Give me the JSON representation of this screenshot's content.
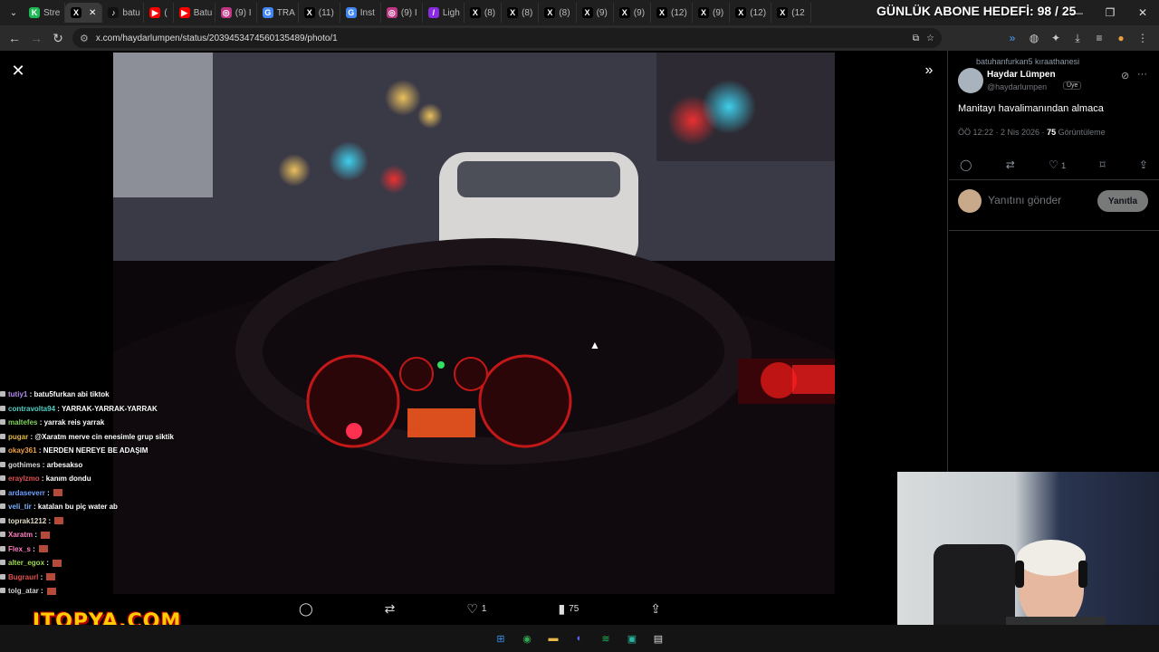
{
  "browser": {
    "tabs": [
      {
        "label": "Stre",
        "color": "#1DB954",
        "glyph": "K",
        "active": false
      },
      {
        "label": "",
        "color": "#000000",
        "glyph": "X",
        "active": true
      },
      {
        "label": "batu",
        "color": "#111111",
        "glyph": "♪",
        "active": false
      },
      {
        "label": "(",
        "color": "#FF0000",
        "glyph": "▶",
        "active": false
      },
      {
        "label": "Batu",
        "color": "#FF0000",
        "glyph": "▶",
        "active": false
      },
      {
        "label": "(9) I",
        "color": "#C13584",
        "glyph": "◎",
        "active": false
      },
      {
        "label": "TRA",
        "color": "#4285F4",
        "glyph": "G",
        "active": false
      },
      {
        "label": "(11)",
        "color": "#000000",
        "glyph": "X",
        "active": false
      },
      {
        "label": "Inst",
        "color": "#4285F4",
        "glyph": "G",
        "active": false
      },
      {
        "label": "(9) I",
        "color": "#C13584",
        "glyph": "◎",
        "active": false
      },
      {
        "label": "Ligh",
        "color": "#8A2BE2",
        "glyph": "/",
        "active": false
      },
      {
        "label": "(8)",
        "color": "#000000",
        "glyph": "X",
        "active": false
      },
      {
        "label": "(8)",
        "color": "#000000",
        "glyph": "X",
        "active": false
      },
      {
        "label": "(8)",
        "color": "#000000",
        "glyph": "X",
        "active": false
      },
      {
        "label": "(9)",
        "color": "#000000",
        "glyph": "X",
        "active": false
      },
      {
        "label": "(9)",
        "color": "#000000",
        "glyph": "X",
        "active": false
      },
      {
        "label": "(12)",
        "color": "#000000",
        "glyph": "X",
        "active": false
      },
      {
        "label": "(9)",
        "color": "#000000",
        "glyph": "X",
        "active": false
      },
      {
        "label": "(12)",
        "color": "#000000",
        "glyph": "X",
        "active": false
      },
      {
        "label": "(12",
        "color": "#000000",
        "glyph": "X",
        "active": false
      }
    ],
    "url": "x.com/haydarlumpen/status/2039453474560135489/photo/1"
  },
  "overlay": {
    "subscriber_goal": "GÜNLÜK ABONE HEDEFİ: 98 / 25",
    "logo": "ITOPYA.COM"
  },
  "tweet": {
    "retweet_label": "batuhanfurkan5 kıraathanesi",
    "author_name": "Haydar Lümpen",
    "author_handle": "@haydarlumpen",
    "member_badge": "Üye",
    "text": "Manitayı havalimanından almaca",
    "time": "ÖÖ 12:22 · 2 Nis 2026 ·",
    "views_count": "75",
    "views_label": "Görüntüleme",
    "likes": "1",
    "reply_placeholder": "Yanıtını gönder",
    "reply_button": "Yanıtla"
  },
  "viewer_actions": {
    "likes": "1",
    "views": "75"
  },
  "chat": [
    {
      "user": "tutiy1",
      "color": "#b48ef0",
      "msg": "batu5furkan abi tiktok",
      "emote": false
    },
    {
      "user": "contravolta94",
      "color": "#4fd1c5",
      "msg": "YARRAK-YARRAK-YARRAK",
      "emote": false
    },
    {
      "user": "maltefes",
      "color": "#7fd35b",
      "msg": "yarrak reis yarrak",
      "emote": false
    },
    {
      "user": "pugar",
      "color": "#e0b84a",
      "msg": "@Xaratm merve cin enesimle grup siktik",
      "emote": false
    },
    {
      "user": "okay361",
      "color": "#f0a048",
      "msg": "NERDEN NEREYE BE ADAŞIM",
      "emote": false
    },
    {
      "user": "gothimes",
      "color": "#d8d8d8",
      "msg": "arbesakso",
      "emote": false
    },
    {
      "user": "eraylzmo",
      "color": "#e05050",
      "msg": "kanım dondu",
      "emote": false
    },
    {
      "user": "ardaseverr",
      "color": "#6fa0ff",
      "msg": "",
      "emote": true
    },
    {
      "user": "veli_tir",
      "color": "#7fb0ff",
      "msg": "katalan bu piç water ab",
      "emote": false
    },
    {
      "user": "toprak1212",
      "color": "#e0d8c8",
      "msg": "",
      "emote": true
    },
    {
      "user": "Xaratm",
      "color": "#ff80c0",
      "msg": "",
      "emote": true
    },
    {
      "user": "Flex_s",
      "color": "#ff7fbf",
      "msg": "",
      "emote": true
    },
    {
      "user": "alter_egox",
      "color": "#9fd84f",
      "msg": "",
      "emote": true
    },
    {
      "user": "Bugraurl",
      "color": "#e05050",
      "msg": "",
      "emote": true
    },
    {
      "user": "tolg_atar",
      "color": "#d0d0d0",
      "msg": "",
      "emote": true
    }
  ],
  "taskbar": [
    {
      "name": "start-icon",
      "color": "#3a8ee6",
      "glyph": "⊞"
    },
    {
      "name": "chrome-icon",
      "color": "#34a853",
      "glyph": "◉"
    },
    {
      "name": "folder-icon",
      "color": "#e8b84a",
      "glyph": "▬"
    },
    {
      "name": "discord-icon",
      "color": "#5865f2",
      "glyph": "◐"
    },
    {
      "name": "spotify-icon",
      "color": "#1db954",
      "glyph": "≋"
    },
    {
      "name": "app-icon",
      "color": "#2bb5a0",
      "glyph": "▣"
    },
    {
      "name": "store-icon",
      "color": "#dddddd",
      "glyph": "▤"
    }
  ]
}
